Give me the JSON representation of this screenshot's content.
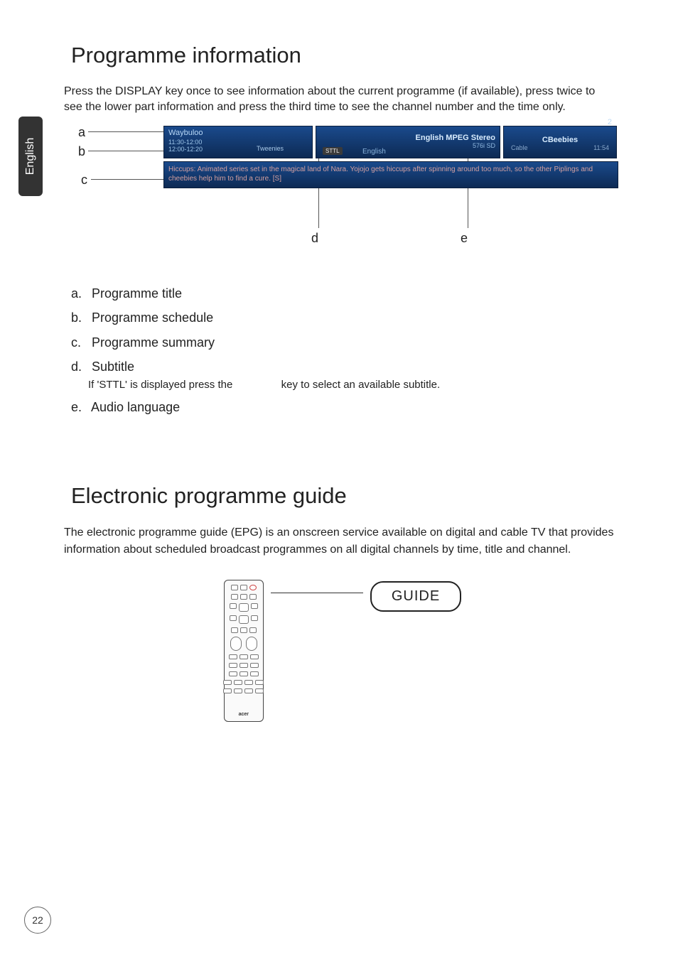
{
  "side_tab": {
    "lang": "English"
  },
  "page_number": "22",
  "section1": {
    "heading": "Programme information",
    "intro": "Press the DISPLAY key once to see information about the current programme (if available), press twice to see the lower part information and press the third time to see the channel number and the time only."
  },
  "osd": {
    "title": "Waybuloo",
    "time_prev": "11:30-12:00",
    "time_now": "12:00-12:20",
    "next_prog": "Tweenies",
    "sttl_badge": "STTL",
    "lang_label": "English",
    "audio_label": "English MPEG Stereo",
    "video_mode": "576i SD",
    "channel_num": "2",
    "channel_name": "CBeebies",
    "source": "Cable",
    "clock": "11:54",
    "summary": "Hiccups: Animated series set in the magical land of Nara. Yojojo gets hiccups after spinning around too much, so the other Piplings and cheebies help him to find a cure. [S]"
  },
  "labels": {
    "a": "a",
    "b": "b",
    "c": "c",
    "d": "d",
    "e": "e"
  },
  "list": {
    "a": {
      "marker": "a.",
      "text": "Programme title"
    },
    "b": {
      "marker": "b.",
      "text": "Programme schedule"
    },
    "c": {
      "marker": "c.",
      "text": "Programme summary"
    },
    "d": {
      "marker": "d.",
      "text": "Subtitle",
      "note_before": "If 'STTL' is displayed press the",
      "note_after": "key to select an available subtitle."
    },
    "e": {
      "marker": "e.",
      "text": "Audio language"
    }
  },
  "section2": {
    "heading": "Electronic programme guide",
    "intro": "The electronic programme guide (EPG) is an onscreen service available on digital and cable TV that provides information about scheduled broadcast programmes on all digital channels by time, title and channel."
  },
  "remote": {
    "brand": "acer"
  },
  "guide_button": "GUIDE"
}
